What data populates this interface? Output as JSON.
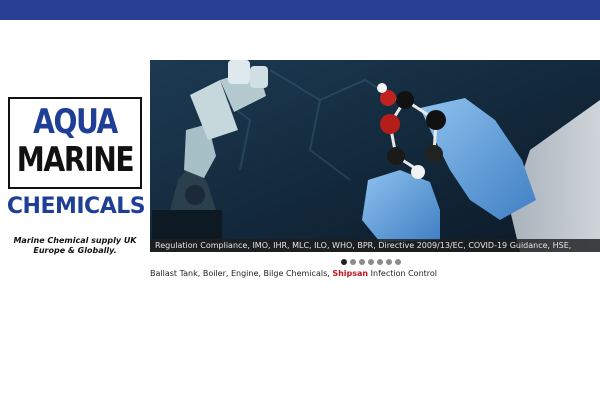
{
  "colors": {
    "topbar": "#293f94",
    "logo_blue": "#1f3f97",
    "logo_black": "#111111",
    "caption_bg": "#1e1e1e",
    "highlight": "#c0141f"
  },
  "logo": {
    "line1": "AQUA",
    "line2": "MARINE",
    "line3": "CHEMICALS"
  },
  "tagline": "Marine Chemical supply UK Europe & Globally.",
  "slider": {
    "image_icon": "laboratory-microscope-molecule-image",
    "caption": "Regulation Compliance, IMO, IHR, MLC, ILO, WHO, BPR, Directive 2009/13/EC, COVID-19 Guidance, HSE,",
    "dots_count": 7,
    "active_dot": 1
  },
  "footer": {
    "text_before": "Ballast Tank, Boiler, Engine, Bilge Chemicals,",
    "highlight": "Shipsan",
    "text_after": "Infection Control"
  }
}
